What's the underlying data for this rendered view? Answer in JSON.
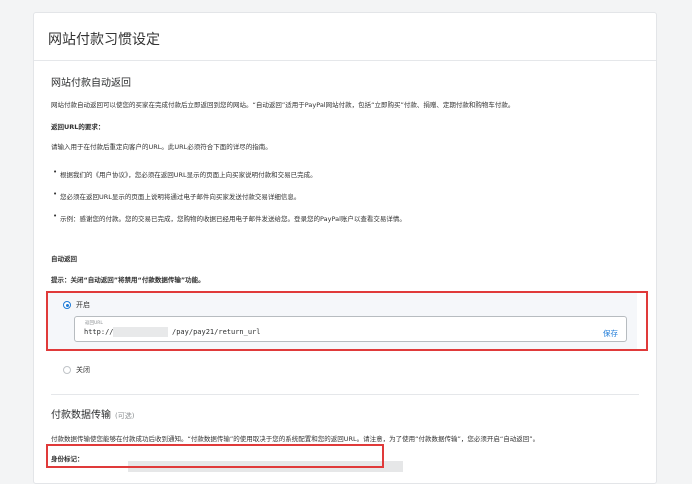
{
  "page": {
    "title": "网站付款习惯设定"
  },
  "auto_return": {
    "heading": "网站付款自动返回",
    "description": "网站付款自动返回可以使您的买家在完成付款后立即返回到您的网站。“自动返回”适用于PayPal网站付款，包括“立即购买”付款、捐赠、定期付款和购物车付款。",
    "requirements_title": "返回URL的要求：",
    "requirements_intro": "请输入用于在付款后重定向客户的URL。此URL必须符合下面的详尽的指南。",
    "bullets": [
      "根据我们的《用户协议》，您必须在返回URL显示的页面上向买家说明付款和交易已完成。",
      "您必须在返回URL显示的页面上说明将通过电子邮件向买家发送付款交易详细信息。",
      "示例：感谢您的付款。您的交易已完成，您购物的收据已经用电子邮件发送给您。登录您的PayPal账户以查看交易详情。"
    ],
    "toggle_title": "自动返回",
    "tip": "提示：关闭“自动返回”将禁用“付款数据传输”功能。",
    "option_on": "开启",
    "option_off": "关闭",
    "selected": "开启",
    "url_field": {
      "label": "返回URL",
      "value_prefix": "http://",
      "value_suffix": "/pay/pay21/return_url"
    },
    "save_label": "保存"
  },
  "pdt": {
    "heading": "付款数据传输",
    "optional": "(可选)",
    "description": "付款数据传输使您能够在付款成功后收到通知。“付款数据传输”的使用取决于您的系统配置和您的返回URL。请注意，为了使用“付款数据传输”，您必须开启“自动返回”。",
    "identity_label": "身份标记："
  },
  "colors": {
    "accent": "#1e7bd8",
    "highlight": "#e03a3a"
  }
}
